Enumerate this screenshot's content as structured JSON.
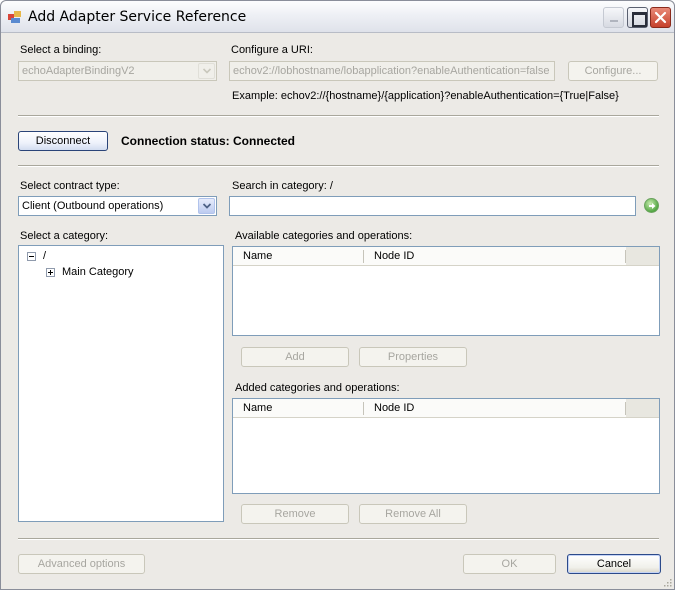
{
  "window": {
    "title": "Add Adapter Service Reference",
    "controls": {
      "minimize": "minimize",
      "maximize": "maximize",
      "close": "close"
    }
  },
  "binding": {
    "label": "Select a binding:",
    "value": "echoAdapterBindingV2"
  },
  "uri": {
    "label": "Configure a URI:",
    "value": "echov2://lobhostname/lobapplication?enableAuthentication=false",
    "configure_button": "Configure...",
    "example": "Example: echov2://{hostname}/{application}?enableAuthentication={True|False}"
  },
  "connection": {
    "disconnect_button": "Disconnect",
    "status_text": "Connection status: Connected"
  },
  "contract": {
    "label": "Select contract type:",
    "value": "Client (Outbound operations)"
  },
  "search": {
    "label": "Search in category: /",
    "value": "",
    "go_icon": "go-arrow-icon"
  },
  "category": {
    "label": "Select a category:",
    "tree": [
      {
        "label": "/",
        "expanded": true
      },
      {
        "label": "Main Category",
        "expanded": false
      }
    ]
  },
  "available": {
    "label": "Available categories and operations:",
    "columns": [
      "Name",
      "Node ID"
    ],
    "rows": [],
    "add_button": "Add",
    "properties_button": "Properties"
  },
  "added": {
    "label": "Added categories and operations:",
    "columns": [
      "Name",
      "Node ID"
    ],
    "rows": [],
    "remove_button": "Remove",
    "remove_all_button": "Remove All"
  },
  "footer": {
    "advanced_button": "Advanced options",
    "ok_button": "OK",
    "cancel_button": "Cancel"
  }
}
